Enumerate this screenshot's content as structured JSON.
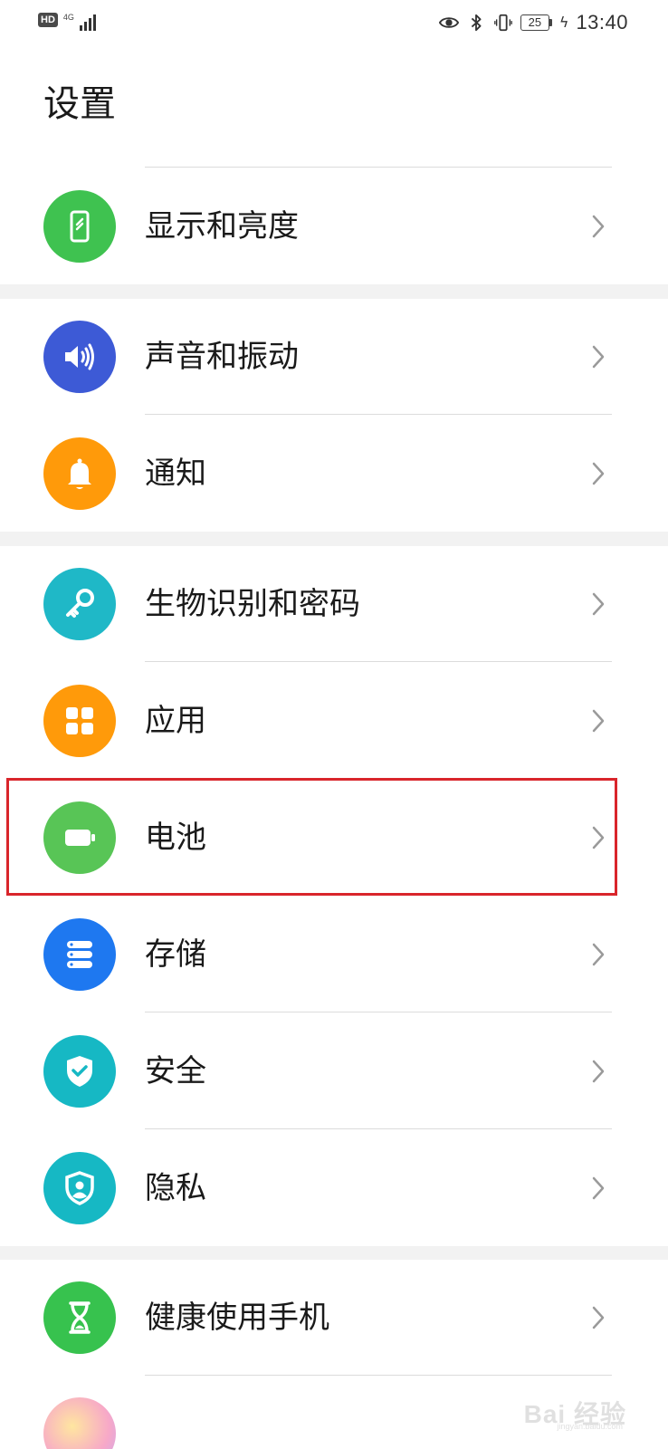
{
  "status_bar": {
    "hd_badge": "HD",
    "network": "4G",
    "battery_level": "25",
    "time": "13:40"
  },
  "title": "设置",
  "colors": {
    "display": "#3fc250",
    "sound": "#3d5ad6",
    "notification": "#ff9a0a",
    "biometrics": "#1fb8c7",
    "apps": "#ff9a0a",
    "battery": "#58c556",
    "storage": "#1e78f0",
    "security": "#16b8c4",
    "privacy": "#16b8c4",
    "digital_balance": "#37c24e",
    "highlight": "#d9252b"
  },
  "settings": [
    {
      "label": "显示和亮度",
      "icon": "phone-screen-icon"
    },
    {
      "label": "声音和振动",
      "icon": "speaker-icon"
    },
    {
      "label": "通知",
      "icon": "bell-icon"
    },
    {
      "label": "生物识别和密码",
      "icon": "key-icon"
    },
    {
      "label": "应用",
      "icon": "grid-icon"
    },
    {
      "label": "电池",
      "icon": "battery-icon"
    },
    {
      "label": "存储",
      "icon": "storage-icon"
    },
    {
      "label": "安全",
      "icon": "shield-check-icon"
    },
    {
      "label": "隐私",
      "icon": "shield-user-icon"
    },
    {
      "label": "健康使用手机",
      "icon": "hourglass-icon"
    }
  ],
  "watermark": {
    "text": "Bai 经验",
    "sub": "jingyan.baidu.com"
  }
}
